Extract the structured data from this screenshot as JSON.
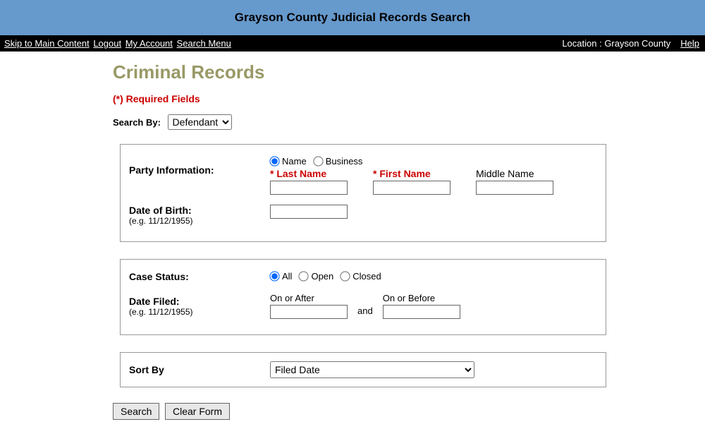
{
  "header": {
    "title": "Grayson County Judicial Records Search"
  },
  "nav": {
    "skip": "Skip to Main Content",
    "logout": "Logout",
    "my_account": "My Account",
    "search_menu": "Search Menu",
    "location": "Location : Grayson County",
    "help": "Help"
  },
  "page": {
    "title": "Criminal Records",
    "required_note": "(*) Required Fields",
    "search_by_label": "Search By:",
    "search_by_value": "Defendant"
  },
  "party": {
    "section_label": "Party Information:",
    "radio_name": "Name",
    "radio_business": "Business",
    "last_name_label": "Last Name",
    "first_name_label": "First Name",
    "middle_name_label": "Middle Name",
    "dob_label": "Date of Birth:",
    "dob_hint": "(e.g. 11/12/1955)"
  },
  "case": {
    "status_label": "Case Status:",
    "radio_all": "All",
    "radio_open": "Open",
    "radio_closed": "Closed",
    "date_filed_label": "Date Filed:",
    "date_filed_hint": "(e.g. 11/12/1955)",
    "on_after": "On or After",
    "on_before": "On or Before",
    "and": "and"
  },
  "sort": {
    "label": "Sort By",
    "value": "Filed Date"
  },
  "buttons": {
    "search": "Search",
    "clear": "Clear Form"
  }
}
